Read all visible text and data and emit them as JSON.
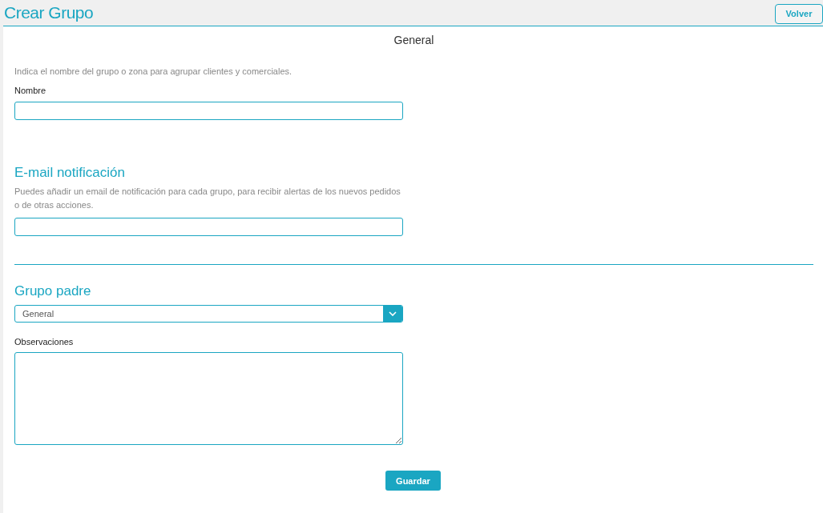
{
  "header": {
    "title": "Crear Grupo",
    "back_button": "Volver"
  },
  "form": {
    "heading": "General",
    "name_section": {
      "description": "Indica el nombre del grupo o zona para agrupar clientes y comerciales.",
      "label": "Nombre"
    },
    "email_section": {
      "title": "E-mail notificación",
      "description": "Puedes añadir un email de notificación para cada grupo, para recibir alertas de los nuevos pedidos o de otras acciones."
    },
    "parent_section": {
      "title": "Grupo padre",
      "select_value": "General"
    },
    "notes_section": {
      "label": "Observaciones"
    },
    "submit_button": "Guardar"
  }
}
